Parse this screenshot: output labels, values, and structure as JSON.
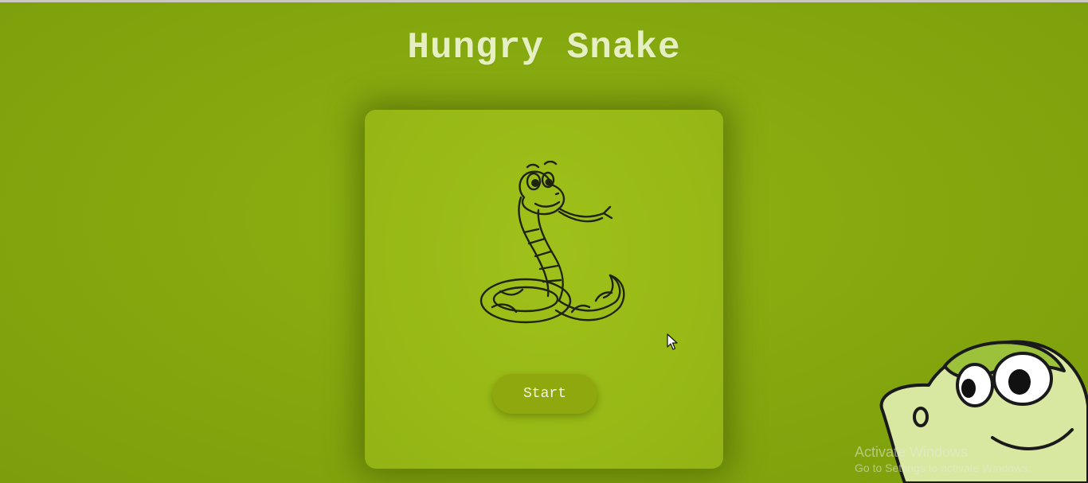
{
  "page": {
    "title": "Hungry Snake"
  },
  "card": {
    "illustration": "coiled-snake-illustration",
    "start_label": "Start"
  },
  "overlay": {
    "mascot": "cartoon-snake-mascot",
    "watermark_line1": "Activate Windows",
    "watermark_line2": "Go to Settings to activate Windows."
  },
  "colors": {
    "background": "#86a90f",
    "card": "#9bbd17",
    "title_text": "#e6efc1",
    "button": "#8ea80d",
    "button_text": "#f4f7e4"
  }
}
